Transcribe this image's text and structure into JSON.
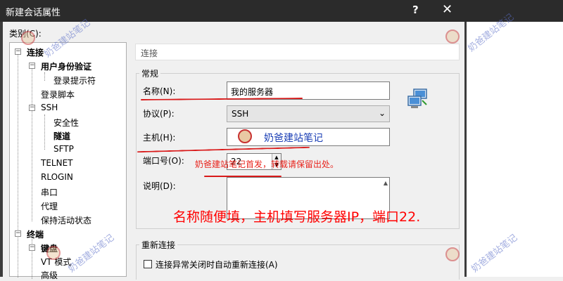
{
  "window": {
    "title": "新建会话属性",
    "help_label": "?",
    "close_label": "✕"
  },
  "category": {
    "label": "类别(C):",
    "tree": [
      {
        "label": "连接",
        "bold": true
      },
      {
        "label": "用户身份验证",
        "bold": true
      },
      {
        "label": "登录提示符",
        "bold": false
      },
      {
        "label": "登录脚本",
        "bold": false
      },
      {
        "label": "SSH",
        "bold": false
      },
      {
        "label": "安全性",
        "bold": false
      },
      {
        "label": "隧道",
        "bold": true
      },
      {
        "label": "SFTP",
        "bold": false
      },
      {
        "label": "TELNET",
        "bold": false
      },
      {
        "label": "RLOGIN",
        "bold": false
      },
      {
        "label": "串口",
        "bold": false
      },
      {
        "label": "代理",
        "bold": false
      },
      {
        "label": "保持活动状态",
        "bold": false
      },
      {
        "label": "终端",
        "bold": true
      },
      {
        "label": "键盘",
        "bold": true
      },
      {
        "label": "VT 模式",
        "bold": false
      },
      {
        "label": "高级",
        "bold": false
      }
    ]
  },
  "panel": {
    "header": "连接",
    "general": {
      "title": "常规",
      "name_label": "名称(N):",
      "name_value": "我的服务器",
      "protocol_label": "协议(P):",
      "protocol_value": "SSH",
      "host_label": "主机(H):",
      "host_value": "",
      "port_label": "端口号(O):",
      "port_value": "22",
      "desc_label": "说明(D):",
      "desc_value": ""
    },
    "reconnect": {
      "title": "重新连接",
      "checkbox_label": "连接异常关闭时自动重新连接(A)",
      "checked": false
    }
  },
  "annotations": {
    "note_red": "奶爸建站笔记首发，转载请保留出处。",
    "big_note": "名称随便填，主机填写服务器IP，端口22.",
    "watermark": "奶爸建站笔记",
    "accent_red": "#e8231c"
  }
}
